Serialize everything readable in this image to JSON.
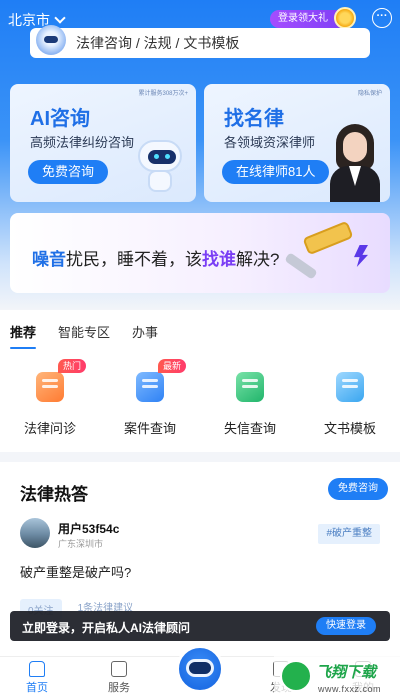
{
  "header": {
    "city": "北京市",
    "gift_label": "登录领大礼",
    "more_label": "···"
  },
  "search": {
    "text": "法律咨询 / 法规 / 文书模板"
  },
  "cards": [
    {
      "tag": "累计服务308万次+",
      "title": "AI咨询",
      "subtitle": "高频法律纠纷咨询",
      "button": "免费咨询"
    },
    {
      "tag": "隐私保护",
      "title": "找名律",
      "subtitle": "各领域资深律师",
      "button": "在线律师81人"
    }
  ],
  "banner": {
    "part1": "噪音",
    "part2": "扰民，睡不着，该",
    "part3": "找谁",
    "part4": "解决?"
  },
  "tabs": [
    "推荐",
    "智能专区",
    "办事"
  ],
  "services": [
    {
      "label": "法律问诊",
      "badge": "热门",
      "color": "orange"
    },
    {
      "label": "案件查询",
      "badge": "最新",
      "color": "blue"
    },
    {
      "label": "失信查询",
      "badge": "",
      "color": "green"
    },
    {
      "label": "文书模板",
      "badge": "",
      "color": "sky"
    }
  ],
  "hot": {
    "title": "法律热答",
    "consult_button": "免费咨询",
    "user": "用户53f54c",
    "location": "广东深圳市",
    "topic": "#破产重整",
    "question": "破产重整是破产吗?",
    "follow": "0关注",
    "lawyers": "1条法律建议"
  },
  "toast": {
    "text": "立即登录，开启私人AI法律顾问",
    "button": "快速登录"
  },
  "nav": {
    "home": "首页",
    "service": "服务",
    "discover": "发现",
    "mine": "我的"
  },
  "watermark": {
    "name": "飞翔下载",
    "url": "www.fxxz.com"
  }
}
